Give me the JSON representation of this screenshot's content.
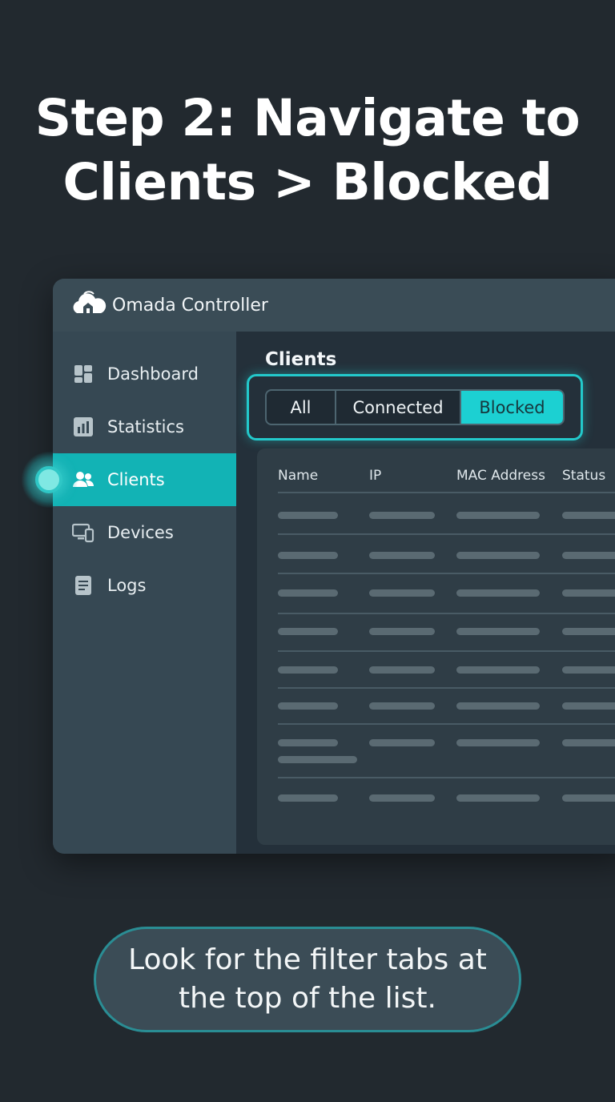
{
  "headline": {
    "line1": "Step 2: Navigate to",
    "line2": "Clients > Blocked"
  },
  "app": {
    "logo_icon": "omada-cloud-home-icon",
    "brand_name": "Omada",
    "brand_suffix": " Controller"
  },
  "sidebar": {
    "items": [
      {
        "label": "Dashboard",
        "icon": "dashboard-icon"
      },
      {
        "label": "Statistics",
        "icon": "bar-chart-icon"
      },
      {
        "label": "Clients",
        "icon": "users-icon",
        "active": true
      },
      {
        "label": "Devices",
        "icon": "devices-icon"
      },
      {
        "label": "Logs",
        "icon": "document-icon"
      }
    ]
  },
  "main": {
    "title": "Clients",
    "tabs": [
      {
        "label": "All"
      },
      {
        "label": "Connected"
      },
      {
        "label": "Blocked",
        "selected": true
      }
    ],
    "table": {
      "columns": [
        "Name",
        "IP",
        "MAC Address",
        "Status"
      ],
      "placeholder_rows": 8
    }
  },
  "tip": {
    "text": "Look for the filter tabs at the top of the list."
  },
  "colors": {
    "accent": "#1cd0d2",
    "background": "#22292f",
    "sidebar": "#364853"
  }
}
